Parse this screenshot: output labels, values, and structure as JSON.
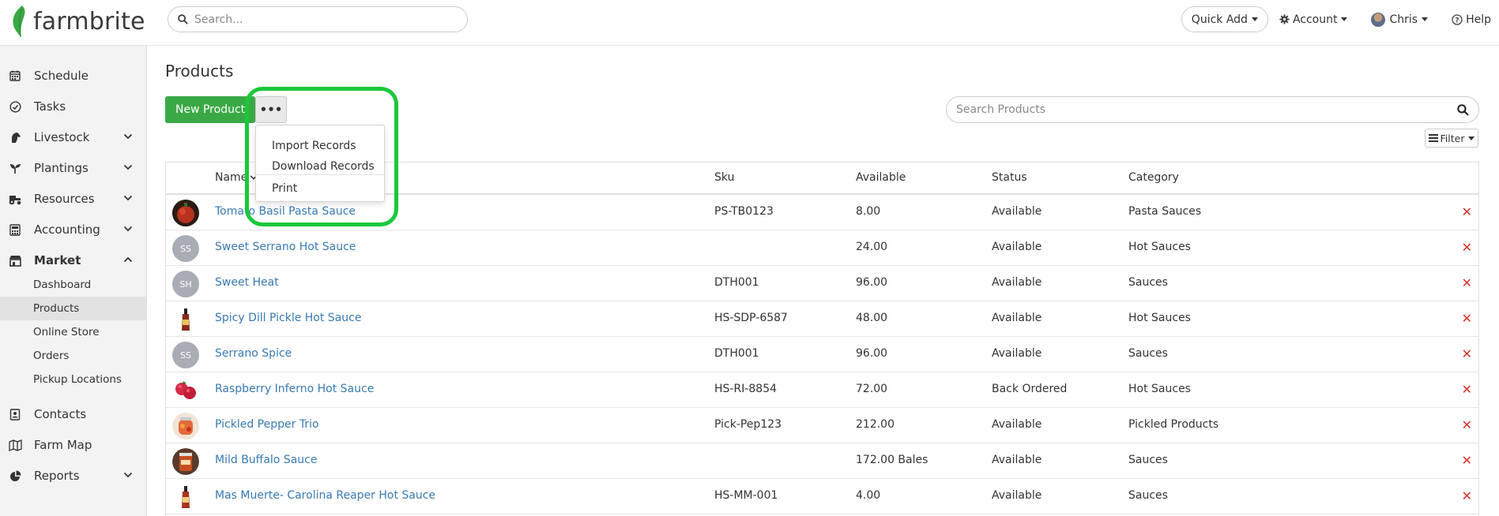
{
  "app": {
    "logo_text": "farmbrite",
    "brand_color": "#3aa845",
    "highlight_color": "#19c93a"
  },
  "header": {
    "search_placeholder": "Search...",
    "quick_add": "Quick Add",
    "account": "Account",
    "user": "Chris",
    "help": "Help"
  },
  "sidebar": {
    "items": [
      {
        "label": "Schedule",
        "icon": "calendar-icon"
      },
      {
        "label": "Tasks",
        "icon": "check-circle-icon"
      },
      {
        "label": "Livestock",
        "icon": "horse-icon"
      },
      {
        "label": "Plantings",
        "icon": "seedling-icon"
      },
      {
        "label": "Resources",
        "icon": "tractor-icon"
      },
      {
        "label": "Accounting",
        "icon": "calculator-icon"
      },
      {
        "label": "Market",
        "icon": "store-icon"
      },
      {
        "label": "Contacts",
        "icon": "address-book-icon"
      },
      {
        "label": "Farm Map",
        "icon": "map-icon"
      },
      {
        "label": "Reports",
        "icon": "pie-chart-icon"
      }
    ],
    "market_sub": [
      {
        "label": "Dashboard"
      },
      {
        "label": "Products"
      },
      {
        "label": "Online Store"
      },
      {
        "label": "Orders"
      },
      {
        "label": "Pickup Locations"
      }
    ]
  },
  "main": {
    "title": "Products",
    "new_button": "New Product",
    "more_button": "•••",
    "menu": {
      "import": "Import Records",
      "download": "Download Records",
      "print": "Print"
    },
    "search_placeholder": "Search Products",
    "filter": "Filter"
  },
  "table": {
    "columns": {
      "name": "Name",
      "sku": "Sku",
      "available": "Available",
      "status": "Status",
      "category": "Category"
    },
    "rows": [
      {
        "name": "Tomato Basil Pasta Sauce",
        "sku": "PS-TB0123",
        "available": "8.00",
        "status": "Available",
        "category": "Pasta Sauces",
        "thumb": "tomato-sauce-image"
      },
      {
        "name": "Sweet Serrano Hot Sauce",
        "sku": "",
        "available": "24.00",
        "status": "Available",
        "category": "Hot Sauces",
        "initials": "SS"
      },
      {
        "name": "Sweet Heat",
        "sku": "DTH001",
        "available": "96.00",
        "status": "Available",
        "category": "Sauces",
        "initials": "SH"
      },
      {
        "name": "Spicy Dill Pickle Hot Sauce",
        "sku": "HS-SDP-6587",
        "available": "48.00",
        "status": "Available",
        "category": "Hot Sauces",
        "thumb": "hot-sauce-bottle-image"
      },
      {
        "name": "Serrano Spice",
        "sku": "DTH001",
        "available": "96.00",
        "status": "Available",
        "category": "Sauces",
        "initials": "SS"
      },
      {
        "name": "Raspberry Inferno Hot Sauce",
        "sku": "HS-RI-8854",
        "available": "72.00",
        "status": "Back Ordered",
        "category": "Hot Sauces",
        "thumb": "raspberry-image"
      },
      {
        "name": "Pickled Pepper Trio",
        "sku": "Pick-Pep123",
        "available": "212.00",
        "status": "Available",
        "category": "Pickled Products",
        "thumb": "pepper-jar-image"
      },
      {
        "name": "Mild Buffalo Sauce",
        "sku": "",
        "available": "172.00 Bales",
        "status": "Available",
        "category": "Sauces",
        "thumb": "buffalo-sauce-jar-image"
      },
      {
        "name": "Mas Muerte- Carolina Reaper Hot Sauce",
        "sku": "HS-MM-001",
        "available": "4.00",
        "status": "Available",
        "category": "Sauces",
        "thumb": "hot-sauce-bottle-image"
      }
    ]
  }
}
